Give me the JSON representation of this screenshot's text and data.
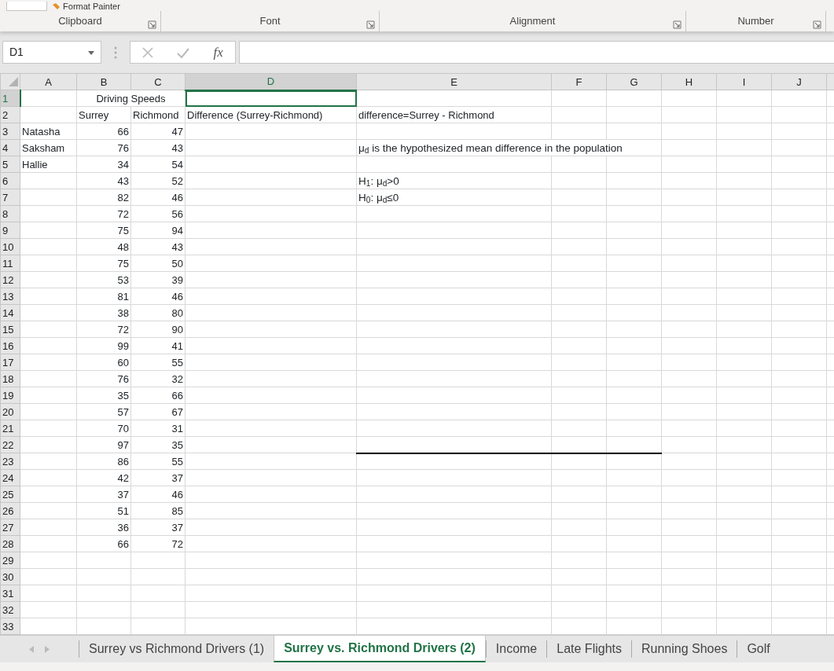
{
  "ribbon": {
    "clipboard_item": "Format Painter",
    "groups": [
      {
        "label": "Clipboard"
      },
      {
        "label": "Font"
      },
      {
        "label": "Alignment"
      },
      {
        "label": "Number"
      }
    ]
  },
  "formula_bar": {
    "name_box": "D1",
    "function_label": "fx"
  },
  "columns": [
    {
      "label": "A",
      "selected": false
    },
    {
      "label": "B",
      "selected": false
    },
    {
      "label": "C",
      "selected": false
    },
    {
      "label": "D",
      "selected": true
    },
    {
      "label": "E",
      "selected": false
    },
    {
      "label": "F",
      "selected": false
    },
    {
      "label": "G",
      "selected": false
    },
    {
      "label": "H",
      "selected": false
    },
    {
      "label": "I",
      "selected": false
    },
    {
      "label": "J",
      "selected": false
    }
  ],
  "rows": [
    {
      "label": "1",
      "selected": true,
      "cells": [
        null,
        {
          "text": "Driving Speeds",
          "kind": "merged"
        }
      ]
    },
    {
      "label": "2",
      "selected": false,
      "cells": [
        null,
        {
          "text": "Surrey",
          "kind": "text"
        },
        {
          "text": "Richmond",
          "kind": "text"
        },
        {
          "text": "Difference  (Surrey-Richmond)",
          "kind": "text"
        },
        {
          "text": "difference=Surrey - Richmond",
          "kind": "text"
        }
      ]
    },
    {
      "label": "3",
      "selected": false,
      "cells": [
        {
          "text": "Natasha",
          "kind": "text"
        },
        {
          "text": "66",
          "kind": "number"
        },
        {
          "text": "47",
          "kind": "number"
        }
      ]
    },
    {
      "label": "4",
      "selected": false,
      "cells": [
        {
          "text": "Saksham",
          "kind": "text"
        },
        {
          "text": "76",
          "kind": "number"
        },
        {
          "text": "43",
          "kind": "number"
        },
        null,
        {
          "text": "μ$_{d}$ is the hypothesized mean difference in the population",
          "kind": "formula"
        }
      ]
    },
    {
      "label": "5",
      "selected": false,
      "cells": [
        {
          "text": "Hallie",
          "kind": "text"
        },
        {
          "text": "34",
          "kind": "number"
        },
        {
          "text": "54",
          "kind": "number"
        }
      ]
    },
    {
      "label": "6",
      "selected": false,
      "cells": [
        null,
        {
          "text": "43",
          "kind": "number"
        },
        {
          "text": "52",
          "kind": "number"
        },
        null,
        {
          "text": "H$_{1}$:  μ$_{d}$>0",
          "kind": "formula"
        }
      ]
    },
    {
      "label": "7",
      "selected": false,
      "cells": [
        null,
        {
          "text": "82",
          "kind": "number"
        },
        {
          "text": "46",
          "kind": "number"
        },
        null,
        {
          "text": "H$_{0}$:  μ$_{d}$≤0",
          "kind": "formula"
        }
      ]
    },
    {
      "label": "8",
      "selected": false,
      "cells": [
        null,
        {
          "text": "72",
          "kind": "number"
        },
        {
          "text": "56",
          "kind": "number"
        }
      ]
    },
    {
      "label": "9",
      "selected": false,
      "cells": [
        null,
        {
          "text": "75",
          "kind": "number"
        },
        {
          "text": "94",
          "kind": "number"
        }
      ]
    },
    {
      "label": "10",
      "selected": false,
      "cells": [
        null,
        {
          "text": "48",
          "kind": "number"
        },
        {
          "text": "43",
          "kind": "number"
        }
      ]
    },
    {
      "label": "11",
      "selected": false,
      "cells": [
        null,
        {
          "text": "75",
          "kind": "number"
        },
        {
          "text": "50",
          "kind": "number"
        }
      ]
    },
    {
      "label": "12",
      "selected": false,
      "cells": [
        null,
        {
          "text": "53",
          "kind": "number"
        },
        {
          "text": "39",
          "kind": "number"
        }
      ]
    },
    {
      "label": "13",
      "selected": false,
      "cells": [
        null,
        {
          "text": "81",
          "kind": "number"
        },
        {
          "text": "46",
          "kind": "number"
        }
      ]
    },
    {
      "label": "14",
      "selected": false,
      "cells": [
        null,
        {
          "text": "38",
          "kind": "number"
        },
        {
          "text": "80",
          "kind": "number"
        }
      ]
    },
    {
      "label": "15",
      "selected": false,
      "cells": [
        null,
        {
          "text": "72",
          "kind": "number"
        },
        {
          "text": "90",
          "kind": "number"
        }
      ]
    },
    {
      "label": "16",
      "selected": false,
      "cells": [
        null,
        {
          "text": "99",
          "kind": "number"
        },
        {
          "text": "41",
          "kind": "number"
        }
      ]
    },
    {
      "label": "17",
      "selected": false,
      "cells": [
        null,
        {
          "text": "60",
          "kind": "number"
        },
        {
          "text": "55",
          "kind": "number"
        }
      ]
    },
    {
      "label": "18",
      "selected": false,
      "cells": [
        null,
        {
          "text": "76",
          "kind": "number"
        },
        {
          "text": "32",
          "kind": "number"
        }
      ]
    },
    {
      "label": "19",
      "selected": false,
      "cells": [
        null,
        {
          "text": "35",
          "kind": "number"
        },
        {
          "text": "66",
          "kind": "number"
        }
      ]
    },
    {
      "label": "20",
      "selected": false,
      "cells": [
        null,
        {
          "text": "57",
          "kind": "number"
        },
        {
          "text": "67",
          "kind": "number"
        }
      ]
    },
    {
      "label": "21",
      "selected": false,
      "cells": [
        null,
        {
          "text": "70",
          "kind": "number"
        },
        {
          "text": "31",
          "kind": "number"
        }
      ]
    },
    {
      "label": "22",
      "selected": false,
      "cells": [
        null,
        {
          "text": "97",
          "kind": "number"
        },
        {
          "text": "35",
          "kind": "number"
        },
        null,
        {
          "bottom_border": true
        },
        {
          "bottom_border": true
        },
        {
          "bottom_border": true
        }
      ]
    },
    {
      "label": "23",
      "selected": false,
      "cells": [
        null,
        {
          "text": "86",
          "kind": "number"
        },
        {
          "text": "55",
          "kind": "number"
        }
      ]
    },
    {
      "label": "24",
      "selected": false,
      "cells": [
        null,
        {
          "text": "42",
          "kind": "number"
        },
        {
          "text": "37",
          "kind": "number"
        }
      ]
    },
    {
      "label": "25",
      "selected": false,
      "cells": [
        null,
        {
          "text": "37",
          "kind": "number"
        },
        {
          "text": "46",
          "kind": "number"
        }
      ]
    },
    {
      "label": "26",
      "selected": false,
      "cells": [
        null,
        {
          "text": "51",
          "kind": "number"
        },
        {
          "text": "85",
          "kind": "number"
        }
      ]
    },
    {
      "label": "27",
      "selected": false,
      "cells": [
        null,
        {
          "text": "36",
          "kind": "number"
        },
        {
          "text": "37",
          "kind": "number"
        }
      ]
    },
    {
      "label": "28",
      "selected": false,
      "cells": [
        null,
        {
          "text": "66",
          "kind": "number"
        },
        {
          "text": "72",
          "kind": "number"
        }
      ]
    },
    {
      "label": "29",
      "selected": false
    },
    {
      "label": "30",
      "selected": false
    },
    {
      "label": "31",
      "selected": false
    },
    {
      "label": "32",
      "selected": false
    },
    {
      "label": "33",
      "selected": false
    }
  ],
  "sheet_tabs": [
    {
      "label": "Surrey vs Richmond Drivers (1)",
      "selected": false
    },
    {
      "label": "Surrey vs. Richmond Drivers (2)",
      "selected": true
    },
    {
      "label": "Income",
      "selected": false
    },
    {
      "label": "Late Flights",
      "selected": false
    },
    {
      "label": "Running Shoes",
      "selected": false
    },
    {
      "label": "Golf",
      "selected": false
    }
  ]
}
